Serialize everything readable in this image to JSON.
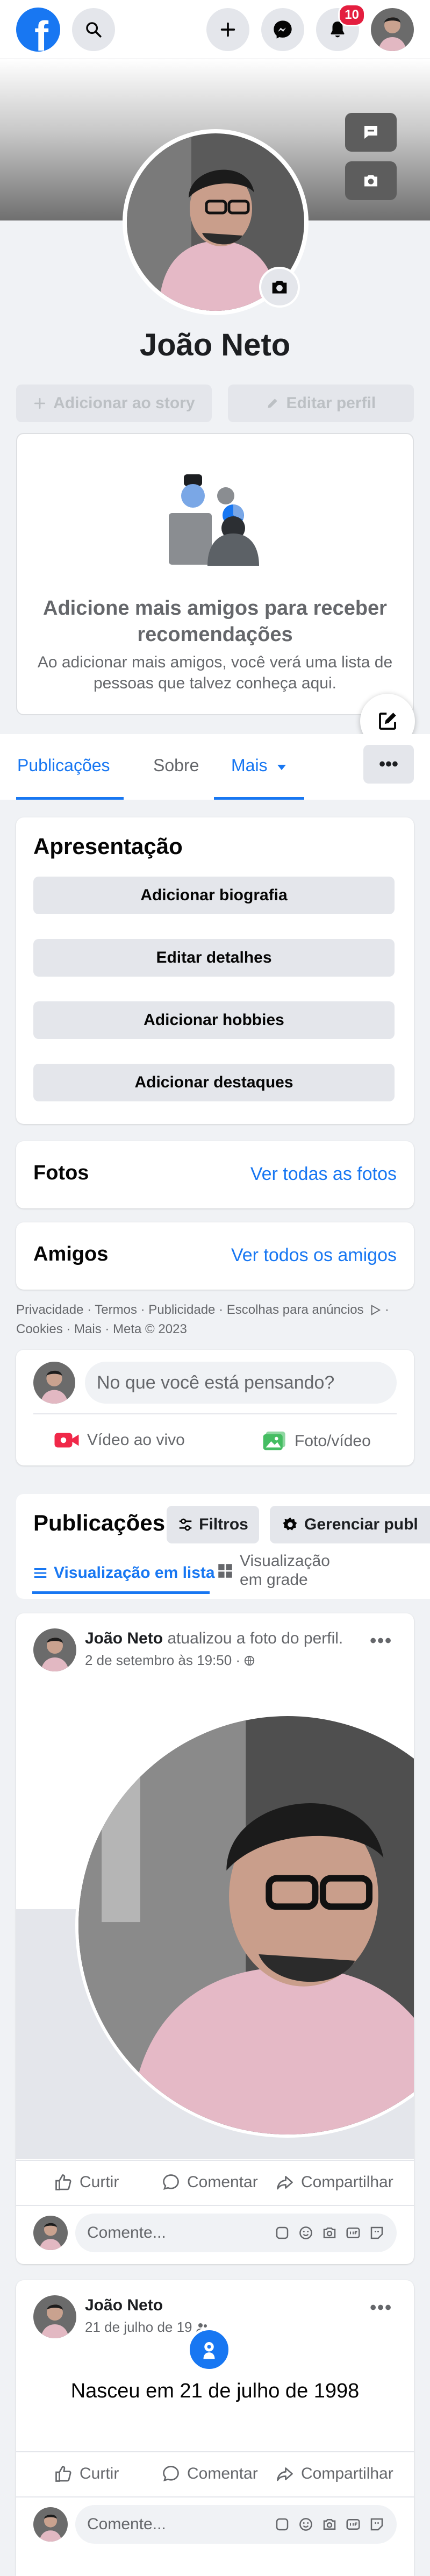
{
  "topbar": {
    "logo_letter": "f",
    "notifications_count": "10",
    "icons": [
      "facebook-logo",
      "search-icon",
      "plus-icon",
      "messenger-icon",
      "bell-icon"
    ]
  },
  "profile": {
    "name": "João Neto",
    "add_story_label": "Adicionar ao story",
    "edit_profile_label": "Editar perfil"
  },
  "recommendations": {
    "title": "Adicione mais amigos para receber recomendações",
    "body": "Ao adicionar mais amigos, você verá uma lista de pessoas que talvez conheça aqui."
  },
  "tabs": {
    "items": [
      "Publicações",
      "Sobre",
      "Mais"
    ],
    "more_label": "•••"
  },
  "intro": {
    "title": "Apresentação",
    "buttons": [
      "Adicionar biografia",
      "Editar detalhes",
      "Adicionar hobbies",
      "Adicionar destaques"
    ]
  },
  "photos": {
    "title": "Fotos",
    "link": "Ver todas as fotos"
  },
  "friends": {
    "title": "Amigos",
    "link": "Ver todos os amigos"
  },
  "footer": {
    "line1": "Privacidade · Termos · Publicidade · Escolhas para anúncios",
    "line2": "Cookies · Mais · Meta © 2023"
  },
  "composer": {
    "placeholder": "No que você está pensando?",
    "live_label": "Vídeo ao vivo",
    "photo_label": "Foto/vídeo"
  },
  "posts_header": {
    "title": "Publicações",
    "filters_label": "Filtros",
    "manage_label": "Gerenciar publ",
    "list_view_label": "Visualização em lista",
    "grid_view_label": "Visualização em grade"
  },
  "post1": {
    "author": "João Neto",
    "action": "atualizou a foto do perfil.",
    "date": "2 de setembro às 19:50 ·"
  },
  "post2": {
    "author": "João Neto",
    "date": "21 de julho de 19",
    "text": "Nasceu em 21 de julho de 1998"
  },
  "post_actions": {
    "like": "Curtir",
    "comment": "Comentar",
    "share": "Compartilhar",
    "comment_placeholder": "Comente..."
  },
  "colors": {
    "brand": "#1877f2",
    "badge": "#e41e3f",
    "live": "#f02849",
    "photo": "#45bd62"
  }
}
